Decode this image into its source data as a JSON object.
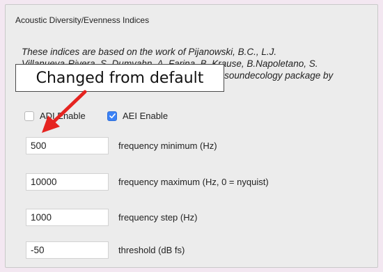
{
  "panel": {
    "title": "Acoustic Diversity/Evenness Indices",
    "description_lines": [
      "These indices are based on the work of Pijanowski, B.C., L.J.",
      "Villanueva-Rivera, S. Dumyahn, A. Farina, B. Krause, B.Napoletano, S.",
      "Gage, and N. Pieretti, and implemented in the R soundecology package by"
    ]
  },
  "annotation": {
    "callout_text": "Changed from default",
    "arrow_color": "#e52420"
  },
  "checkboxes": [
    {
      "label": "ADI Enable",
      "checked": false
    },
    {
      "label": "AEI Enable",
      "checked": true
    }
  ],
  "fields": [
    {
      "value": "500",
      "label": "frequency minimum (Hz)"
    },
    {
      "value": "10000",
      "label": "frequency maximum (Hz, 0 = nyquist)"
    },
    {
      "value": "1000",
      "label": "frequency step (Hz)"
    },
    {
      "value": "-50",
      "label": "threshold (dB fs)"
    }
  ],
  "colors": {
    "checkbox_accent": "#3b82f6",
    "background": "#f3e7f1",
    "panel": "#ececec"
  }
}
